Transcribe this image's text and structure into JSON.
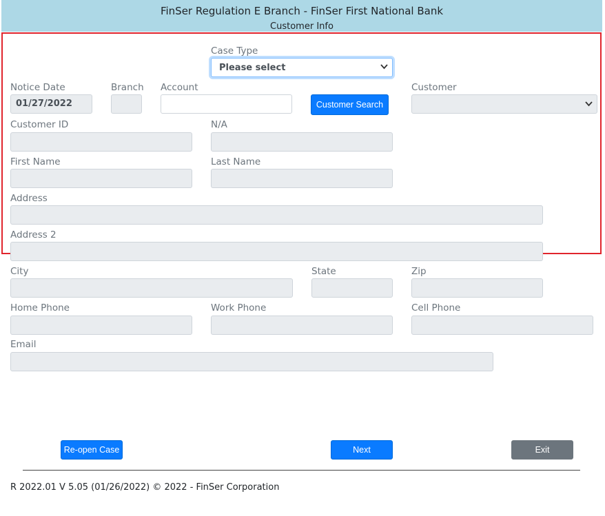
{
  "header": {
    "title": "FinSer Regulation E Branch - FinSer First National Bank",
    "subtitle": "Customer Info"
  },
  "form": {
    "case_type": {
      "label": "Case Type",
      "value": "Please select"
    },
    "notice_date": {
      "label": "Notice Date",
      "value": "01/27/2022"
    },
    "branch": {
      "label": "Branch",
      "value": ""
    },
    "account": {
      "label": "Account",
      "value": ""
    },
    "customer_search_label": "Customer Search",
    "customer": {
      "label": "Customer",
      "value": ""
    },
    "customer_id": {
      "label": "Customer ID",
      "value": ""
    },
    "na": {
      "label": "N/A",
      "value": ""
    },
    "first_name": {
      "label": "First Name",
      "value": ""
    },
    "last_name": {
      "label": "Last Name",
      "value": ""
    },
    "address": {
      "label": "Address",
      "value": ""
    },
    "address2": {
      "label": "Address 2",
      "value": ""
    },
    "city": {
      "label": "City",
      "value": ""
    },
    "state": {
      "label": "State",
      "value": ""
    },
    "zip": {
      "label": "Zip",
      "value": ""
    },
    "home_phone": {
      "label": "Home Phone",
      "value": ""
    },
    "work_phone": {
      "label": "Work Phone",
      "value": ""
    },
    "cell_phone": {
      "label": "Cell Phone",
      "value": ""
    },
    "email": {
      "label": "Email",
      "value": ""
    }
  },
  "buttons": {
    "reopen_label": "Re-open Case",
    "next_label": "Next",
    "exit_label": "Exit"
  },
  "icons": {
    "dropdown": "chevron-down-icon"
  },
  "colors": {
    "header_bg": "#add8e6",
    "highlight_border": "#e0242c",
    "primary": "#0a7bff",
    "secondary": "#6c757d"
  },
  "footer": {
    "text": "R 2022.01 V 5.05 (01/26/2022) © 2022 - FinSer Corporation"
  }
}
